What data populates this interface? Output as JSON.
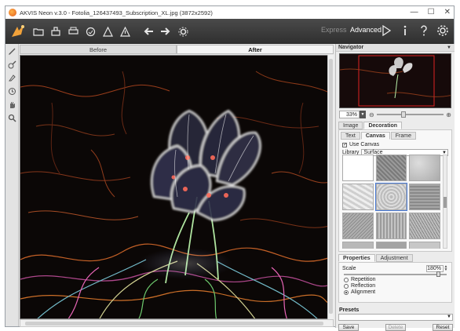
{
  "window": {
    "title": "AKVIS Neon v.3.0 - Fotolia_126437493_Subscription_XL.jpg (3872x2592)",
    "controls": [
      "—",
      "☐",
      "✕"
    ]
  },
  "toolbar": {
    "modes": {
      "express": "Express",
      "advanced": "Advanced"
    }
  },
  "view_tabs": {
    "before": "Before",
    "after": "After"
  },
  "panel": {
    "navigator_title": "Navigator",
    "zoom_value": "33%",
    "main_tabs": [
      "Image",
      "Decoration"
    ],
    "sub_tabs": [
      "Text",
      "Canvas",
      "Frame"
    ],
    "use_canvas_label": "Use Canvas",
    "use_canvas_checked": true,
    "library_label": "Library",
    "library_value": "Surface",
    "property_tabs": [
      "Properties",
      "Adjustment"
    ],
    "scale_label": "Scale",
    "scale_value": "180%",
    "radio_options": [
      "Repetition",
      "Reflection",
      "Alignment"
    ],
    "radio_selected": "Alignment",
    "presets_title": "Presets",
    "buttons": {
      "save": "Save",
      "delete": "Delete",
      "reset": "Reset"
    }
  },
  "colors": {
    "toolbar_bg": "#3a3a3a",
    "canvas_bg": "#0b0706",
    "active_mode": "#ffffff"
  },
  "icons": {
    "toolbar": [
      "open-icon",
      "save-icon",
      "print-icon",
      "share-icon",
      "batch-icon",
      "brush-icon",
      "back-icon",
      "forward-icon",
      "settings-gear-icon"
    ],
    "toolbar_right": [
      "run-icon",
      "info-icon",
      "help-icon",
      "gear-icon"
    ],
    "left_tools": [
      "stroke-tool-icon",
      "brush-tool-icon",
      "eraser-tool-icon",
      "history-brush-icon",
      "hand-tool-icon",
      "zoom-tool-icon"
    ]
  }
}
